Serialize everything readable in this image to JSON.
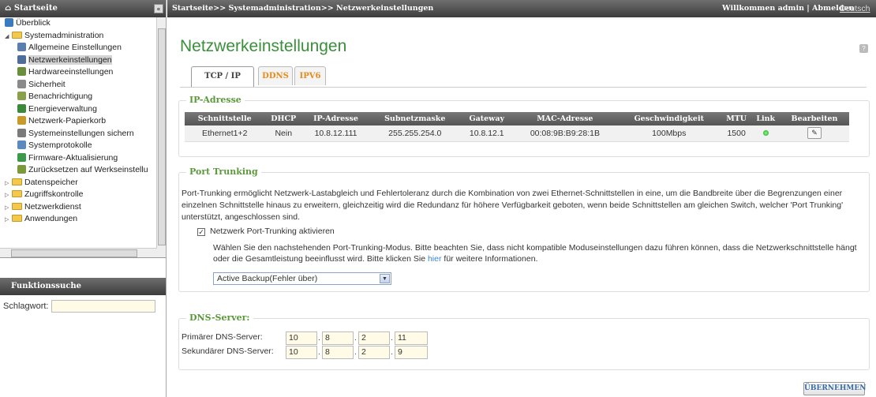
{
  "sidebar": {
    "title": "Startseite",
    "items": [
      {
        "label": "Überblick",
        "icon": "overview-icon",
        "color": "#3a7ac0"
      },
      {
        "label": "Systemadministration",
        "icon": "folder-open-icon"
      },
      {
        "label": "Allgemeine Einstellungen",
        "icon": "settings-icon",
        "color": "#5a7fae"
      },
      {
        "label": "Netzwerkeinstellungen",
        "icon": "network-icon",
        "color": "#4d6e9a"
      },
      {
        "label": "Hardwareeinstellungen",
        "icon": "hardware-icon",
        "color": "#6a8f3a"
      },
      {
        "label": "Sicherheit",
        "icon": "lock-icon",
        "color": "#8a8a8a"
      },
      {
        "label": "Benachrichtigung",
        "icon": "notification-icon",
        "color": "#8aa04a"
      },
      {
        "label": "Energieverwaltung",
        "icon": "power-icon",
        "color": "#3a8a3a"
      },
      {
        "label": "Netzwerk-Papierkorb",
        "icon": "recycle-bin-icon",
        "color": "#c99a2a"
      },
      {
        "label": "Systemeinstellungen sichern",
        "icon": "backup-icon",
        "color": "#7a7a7a"
      },
      {
        "label": "Systemprotokolle",
        "icon": "logs-icon",
        "color": "#5a8ac0"
      },
      {
        "label": "Firmware-Aktualisierung",
        "icon": "firmware-icon",
        "color": "#3a9a4a"
      },
      {
        "label": "Zurücksetzen auf Werkseinstellu",
        "icon": "reset-icon",
        "color": "#7a9a3a"
      },
      {
        "label": "Datenspeicher",
        "icon": "folder-icon"
      },
      {
        "label": "Zugriffskontrolle",
        "icon": "folder-icon"
      },
      {
        "label": "Netzwerkdienst",
        "icon": "folder-icon"
      },
      {
        "label": "Anwendungen",
        "icon": "folder-icon"
      }
    ],
    "function_search_title": "Funktionssuche",
    "keyword_label": "Schlagwort:",
    "keyword_value": ""
  },
  "topbar": {
    "breadcrumb": "Startseite>> Systemadministration>> Netzwerkeinstellungen",
    "welcome": "Willkommen admin | Abmelden",
    "language": "Deutsch"
  },
  "page": {
    "title": "Netzwerkeinstellungen",
    "tabs": [
      "TCP / IP",
      "DDNS",
      "IPV6"
    ],
    "active_tab": "TCP / IP"
  },
  "ip_section": {
    "legend": "IP-Adresse",
    "columns": [
      "Schnittstelle",
      "DHCP",
      "IP-Adresse",
      "Subnetzmaske",
      "Gateway",
      "MAC-Adresse",
      "Geschwindigkeit",
      "MTU",
      "Link",
      "Bearbeiten"
    ],
    "rows": [
      {
        "interface": "Ethernet1+2",
        "dhcp": "Nein",
        "ip": "10.8.12.111",
        "subnet": "255.255.254.0",
        "gateway": "10.8.12.1",
        "mac": "00:08:9B:B9:28:1B",
        "speed": "100Mbps",
        "mtu": "1500",
        "link": "up"
      }
    ]
  },
  "port_trunking": {
    "legend": "Port Trunking",
    "description": "Port-Trunking ermöglicht Netzwerk-Lastabgleich und Fehlertoleranz durch die Kombination von zwei Ethernet-Schnittstellen in eine, um die Bandbreite über die Begrenzungen einer einzelnen Schnittstelle hinaus zu erweitern, gleichzeitig wird die Redundanz für höhere Verfügbarkeit geboten, wenn beide Schnittstellen am gleichen Switch, welcher 'Port Trunking' unterstützt, angeschlossen sind.",
    "checkbox_label": "Netzwerk Port-Trunking aktivieren",
    "checkbox_checked": true,
    "note_before": "Wählen Sie den nachstehenden Port-Trunking-Modus. Bitte beachten Sie, dass nicht kompatible Moduseinstellungen dazu führen können, dass die Netzwerkschnittstelle hängt oder die Gesamtleistung beeinflusst wird. Bitte klicken Sie ",
    "note_link": "hier",
    "note_after": " für weitere Informationen.",
    "mode_selected": "Active Backup(Fehler über)"
  },
  "dns": {
    "legend": "DNS-Server:",
    "primary_label": "Primärer DNS-Server:",
    "primary": [
      "10",
      "8",
      "2",
      "11"
    ],
    "secondary_label": "Sekundärer DNS-Server:",
    "secondary": [
      "10",
      "8",
      "2",
      "9"
    ]
  },
  "apply_label": "ÜBERNEHMEN"
}
